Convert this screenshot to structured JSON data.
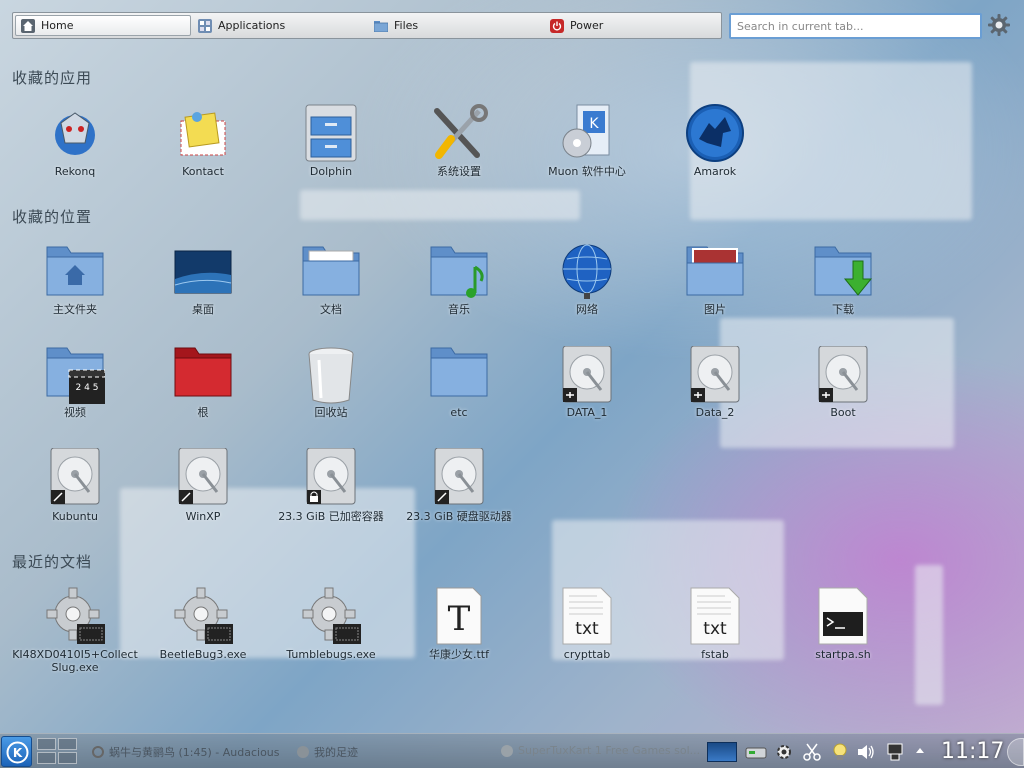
{
  "launcher": {
    "tabs": [
      {
        "label": "Home",
        "icon": "home-icon"
      },
      {
        "label": "Applications",
        "icon": "applications-icon"
      },
      {
        "label": "Files",
        "icon": "files-icon"
      },
      {
        "label": "Power",
        "icon": "power-icon"
      }
    ],
    "search_placeholder": "Search in current tab..."
  },
  "sections": {
    "apps_title": "收藏的应用",
    "places_title": "收藏的位置",
    "recent_title": "最近的文档"
  },
  "apps": [
    {
      "label": "Rekonq",
      "icon": "rekonq-icon"
    },
    {
      "label": "Kontact",
      "icon": "kontact-icon"
    },
    {
      "label": "Dolphin",
      "icon": "dolphin-icon"
    },
    {
      "label": "系统设置",
      "icon": "system-settings-icon"
    },
    {
      "label": "Muon 软件中心",
      "icon": "muon-icon"
    },
    {
      "label": "Amarok",
      "icon": "amarok-icon"
    }
  ],
  "places": [
    {
      "label": "主文件夹",
      "icon": "home-folder-icon"
    },
    {
      "label": "桌面",
      "icon": "desktop-icon"
    },
    {
      "label": "文档",
      "icon": "documents-folder-icon"
    },
    {
      "label": "音乐",
      "icon": "music-folder-icon"
    },
    {
      "label": "网络",
      "icon": "network-globe-icon"
    },
    {
      "label": "图片",
      "icon": "pictures-folder-icon"
    },
    {
      "label": "下载",
      "icon": "downloads-folder-icon"
    },
    {
      "label": "视频",
      "icon": "videos-folder-icon"
    },
    {
      "label": "根",
      "icon": "root-folder-icon"
    },
    {
      "label": "回收站",
      "icon": "trash-icon"
    },
    {
      "label": "etc",
      "icon": "folder-icon"
    },
    {
      "label": "DATA_1",
      "icon": "harddisk-icon"
    },
    {
      "label": "Data_2",
      "icon": "harddisk-icon"
    },
    {
      "label": "Boot",
      "icon": "harddisk-icon"
    },
    {
      "label": "Kubuntu",
      "icon": "harddisk-icon"
    },
    {
      "label": "WinXP",
      "icon": "harddisk-icon"
    },
    {
      "label": "23.3 GiB 已加密容器",
      "icon": "encrypted-harddisk-icon"
    },
    {
      "label": "23.3 GiB 硬盘驱动器",
      "icon": "harddisk-icon"
    }
  ],
  "recent": [
    {
      "label": "KI48XD0410I5+Collect Slug.exe",
      "icon": "executable-icon"
    },
    {
      "label": "BeetleBug3.exe",
      "icon": "executable-icon"
    },
    {
      "label": "Tumblebugs.exe",
      "icon": "executable-icon"
    },
    {
      "label": "华康少女.ttf",
      "icon": "font-file-icon"
    },
    {
      "label": "crypttab",
      "icon": "text-file-icon"
    },
    {
      "label": "fstab",
      "icon": "text-file-icon"
    },
    {
      "label": "startpa.sh",
      "icon": "shell-script-icon"
    }
  ],
  "taskbar": {
    "tasks": [
      {
        "label": "蜗牛与黄鹂鸟 (1:45) - Audacious"
      },
      {
        "label": "我的足迹"
      },
      {
        "label": "SuperTuxKart 1 Free Games sol..."
      }
    ],
    "clock": "11:17"
  },
  "colors": {
    "folder_blue": "#7aa6d6",
    "root_folder_red": "#c9222a",
    "search_border": "#6a9ed4",
    "kde_blue": "#2a7ed0"
  }
}
